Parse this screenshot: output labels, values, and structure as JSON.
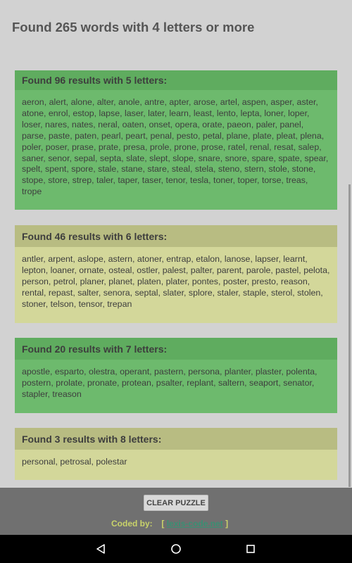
{
  "header": {
    "title": "Found 265 words with 4 letters or more"
  },
  "sections": [
    {
      "title": "Found 96 results with 5 letters:",
      "words": "aeron, alert, alone, alter, anole, antre, apter, arose, artel, aspen, asper, aster, atone, enrol, estop, lapse, laser, later, learn, least, lento, lepta, loner, loper, loser, nares, nates, neral, oaten, onset, opera, orate, paeon, paler, panel, parse, paste, paten, pearl, peart, penal, pesto, petal, plane, plate, pleat, plena, poler, poser, prase, prate, presa, prole, prone, prose, ratel, renal, resat, salep, saner, senor, sepal, septa, slate, slept, slope, snare, snore, spare, spate, spear, spelt, spent, spore, stale, stane, stare, steal, stela, steno, stern, stole, stone, stope, store, strep, taler, taper, taser, tenor, tesla, toner, toper, torse, treas, trope"
    },
    {
      "title": "Found 46 results with 6 letters:",
      "words": "antler, arpent, aslope, astern, atoner, entrap, etalon, lanose, lapser, learnt, lepton, loaner, ornate, osteal, ostler, palest, palter, parent, parole, pastel, pelota, person, petrol, planer, planet, platen, plater, pontes, poster, presto, reason, rental, repast, salter, senora, septal, slater, splore, staler, staple, sterol, stolen, stoner, telson, tensor, trepan"
    },
    {
      "title": "Found 20 results with 7 letters:",
      "words": "apostle, esparto, olestra, operant, pastern, persona, planter, plaster, polenta, postern, prolate, pronate, protean, psalter, replant, saltern, seaport, senator, stapler, treason"
    },
    {
      "title": "Found 3 results with 8 letters:",
      "words": "personal, petrosal, polestar"
    }
  ],
  "footer": {
    "clear_label": "CLEAR PUZZLE",
    "coded_prefix": "Coded by:",
    "bracket_open": "[",
    "link_text": "lexis-code.net",
    "bracket_close": "]"
  },
  "nav": {
    "back": "back-icon",
    "home": "home-icon",
    "recents": "recents-icon"
  }
}
